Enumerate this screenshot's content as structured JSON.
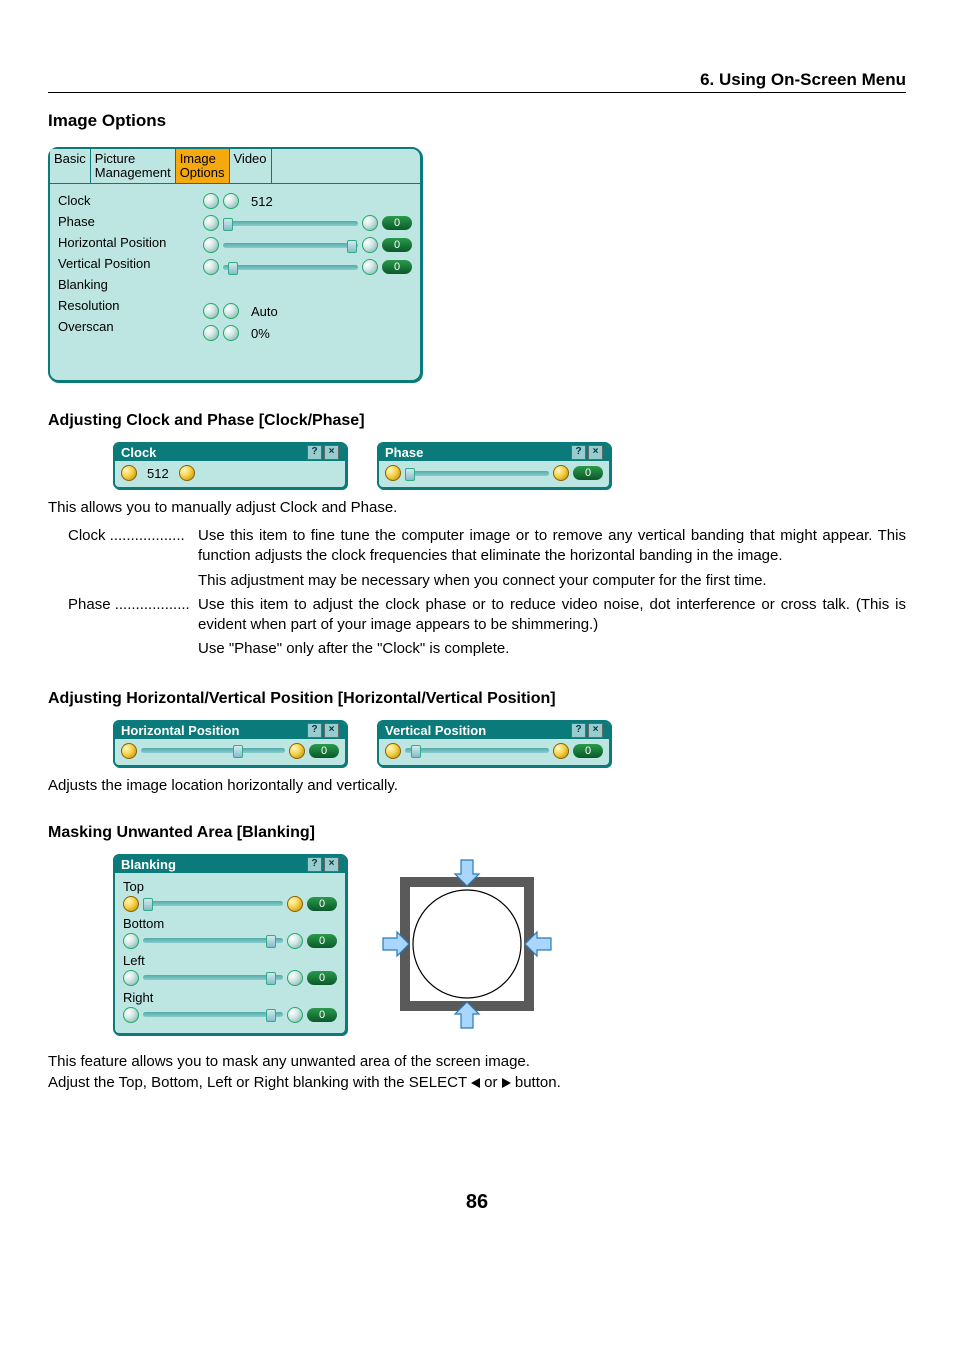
{
  "breadcrumb": "6. Using On-Screen Menu",
  "h1": "Image Options",
  "osd": {
    "tabs": [
      "Basic",
      "Picture\nManagement",
      "Image\nOptions",
      "Video"
    ],
    "selected_tab_index": 2,
    "rows": [
      {
        "label": "Clock",
        "kind": "value",
        "value": "512"
      },
      {
        "label": "Phase",
        "kind": "slider",
        "pill": "0",
        "thumb_pct": 0
      },
      {
        "label": "Horizontal Position",
        "kind": "slider",
        "pill": "0",
        "thumb_pct": 92
      },
      {
        "label": "Vertical Position",
        "kind": "slider",
        "pill": "0",
        "thumb_pct": 4
      },
      {
        "label": "Blanking",
        "kind": "blank"
      },
      {
        "label": "Resolution",
        "kind": "value",
        "value": "Auto"
      },
      {
        "label": "Overscan",
        "kind": "value",
        "value": "0%"
      }
    ]
  },
  "clockphase": {
    "heading": "Adjusting Clock and Phase [Clock/Phase]",
    "clock_window": {
      "title": "Clock",
      "value": "512"
    },
    "phase_window": {
      "title": "Phase",
      "pill": "0",
      "thumb_pct": 0
    },
    "intro": "This allows you to manually adjust Clock and Phase.",
    "defs": [
      {
        "term": "Clock",
        "lines": [
          "Use this item to fine tune the computer image or to remove any vertical banding that might appear. This function adjusts the clock frequencies that eliminate the horizontal banding in the image.",
          "This adjustment may be necessary when you connect your computer for the first time."
        ]
      },
      {
        "term": "Phase",
        "lines": [
          "Use this item to adjust the clock phase or to reduce video noise, dot interference or cross talk. (This is evident when part of your image appears to be shimmering.)",
          "Use \"Phase\" only after the \"Clock\" is complete."
        ]
      }
    ]
  },
  "hvpos": {
    "heading": "Adjusting Horizontal/Vertical Position [Horizontal/Vertical Position]",
    "h_window": {
      "title": "Horizontal Position",
      "pill": "0",
      "thumb_pct": 64
    },
    "v_window": {
      "title": "Vertical Position",
      "pill": "0",
      "thumb_pct": 4
    },
    "text": "Adjusts the image location horizontally and vertically."
  },
  "blanking": {
    "heading": "Masking Unwanted Area [Blanking]",
    "window_title": "Blanking",
    "items": [
      {
        "label": "Top",
        "pill": "0",
        "thumb_pct": 0,
        "active": true
      },
      {
        "label": "Bottom",
        "pill": "0",
        "thumb_pct": 88,
        "active": false
      },
      {
        "label": "Left",
        "pill": "0",
        "thumb_pct": 88,
        "active": false
      },
      {
        "label": "Right",
        "pill": "0",
        "thumb_pct": 88,
        "active": false
      }
    ],
    "text1": "This feature allows you to mask any unwanted area of the screen image.",
    "text2_a": "Adjust the Top, Bottom, Left or Right blanking with the SELECT ",
    "text2_b": " or ",
    "text2_c": " button."
  },
  "page_number": "86"
}
